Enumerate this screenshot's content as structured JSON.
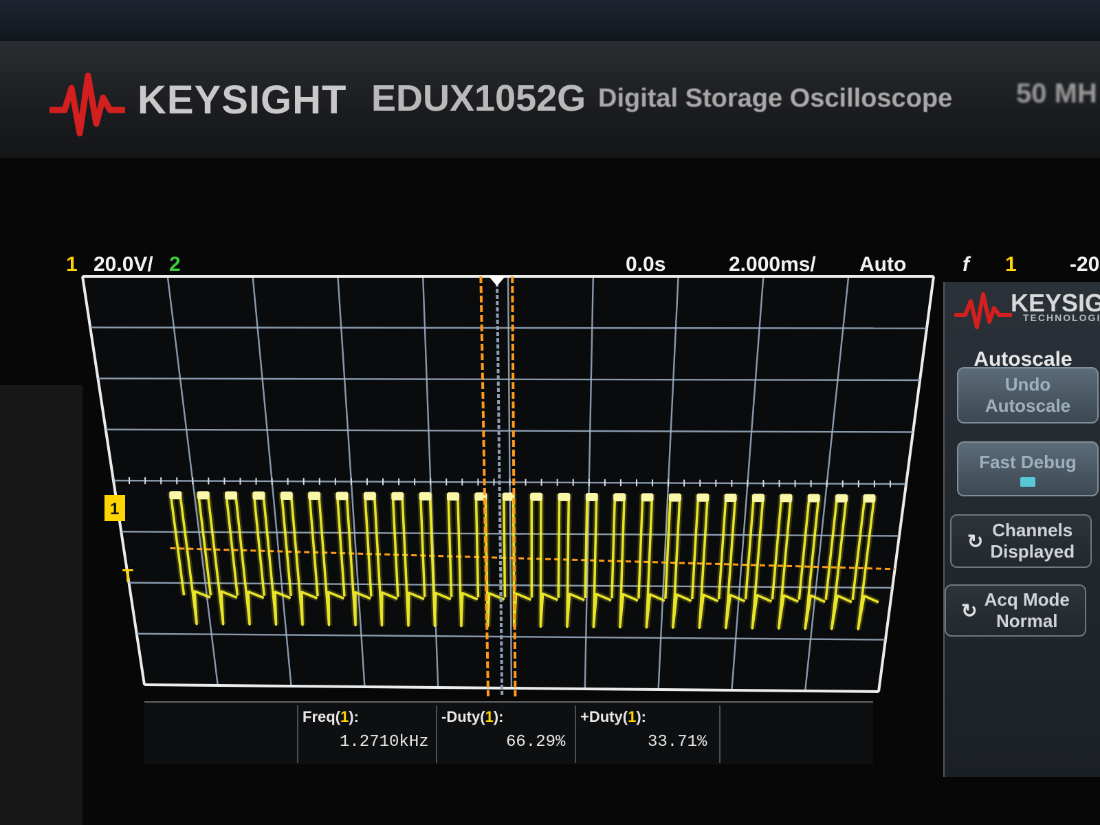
{
  "bezel": {
    "brand": "KEYSIGHT",
    "model": "EDUX1052G",
    "description": "Digital Storage Oscilloscope",
    "bandwidth": "50 MH",
    "brand_color": "#d21f1f"
  },
  "status_bar": {
    "channel1_number": "1",
    "channel1_scale": "20.0V/",
    "channel2_number": "2",
    "time_delay": "0.0s",
    "time_scale": "2.000ms/",
    "trigger_mode": "Auto",
    "trigger_slope_symbol": "f",
    "trigger_source": "1",
    "trigger_level": "-20",
    "channel1_color": "#ffd400",
    "channel2_color": "#3ccd3c"
  },
  "side_panel": {
    "brand": "KEYSIGHT",
    "brand_sub": "TECHNOLOGIES",
    "title": "Autoscale",
    "undo_autoscale": [
      "Undo",
      "Autoscale"
    ],
    "fast_debug": "Fast Debug",
    "channels_displayed": [
      "Channels",
      "Displayed"
    ],
    "acq_mode": [
      "Acq Mode",
      "Normal"
    ],
    "loop_icon": "loop-arrow-icon"
  },
  "measurements": [
    {
      "name": "Freq",
      "channel": "1",
      "value": "1.2710kHz"
    },
    {
      "name": "-Duty",
      "channel": "1",
      "value": "66.29%"
    },
    {
      "name": "+Duty",
      "channel": "1",
      "value": "33.71%"
    }
  ],
  "markers": {
    "channel1_ground": "1",
    "trigger_level_marker": "T"
  },
  "waveform": {
    "pulse_count": 26,
    "trace_color": "#f2ef2a",
    "trigger_line_color": "#ff9a1a",
    "grid_color": "#9fb2c8"
  }
}
